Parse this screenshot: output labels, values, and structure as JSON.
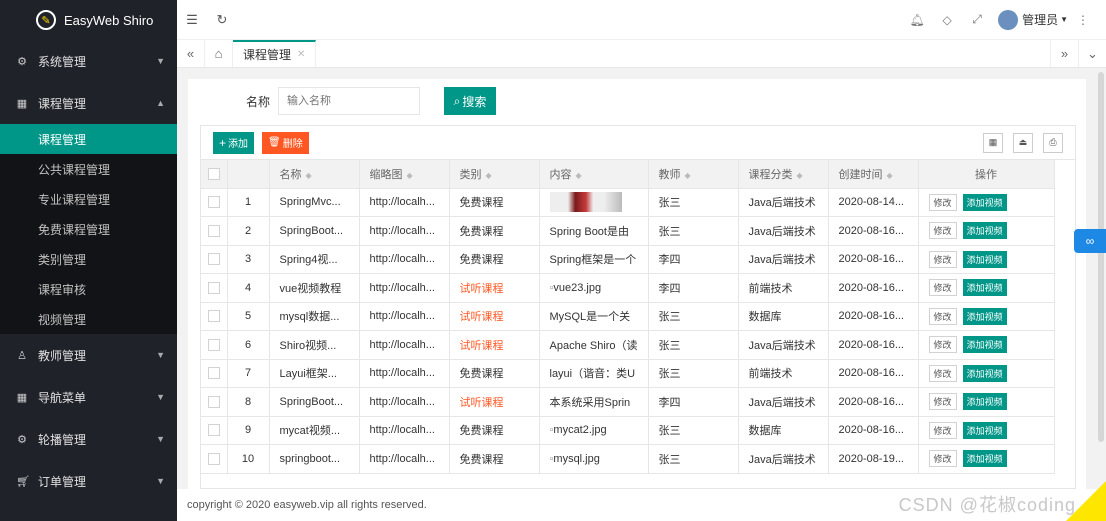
{
  "app": {
    "title": "EasyWeb Shiro"
  },
  "sidebar": {
    "groups": [
      {
        "label": "系统管理",
        "icon": "gear-icon",
        "expanded": false
      },
      {
        "label": "课程管理",
        "icon": "apps-icon",
        "expanded": true,
        "items": [
          "课程管理",
          "公共课程管理",
          "专业课程管理",
          "免费课程管理",
          "类别管理",
          "课程审核",
          "视频管理"
        ],
        "active_item": "课程管理"
      },
      {
        "label": "教师管理",
        "icon": "user-icon",
        "expanded": false
      },
      {
        "label": "导航菜单",
        "icon": "apps-icon",
        "expanded": false
      },
      {
        "label": "轮播管理",
        "icon": "gear-icon",
        "expanded": false
      },
      {
        "label": "订单管理",
        "icon": "cart-icon",
        "expanded": false
      }
    ]
  },
  "header": {
    "user": "管理员"
  },
  "tabs": [
    {
      "label": "课程管理",
      "active": true
    }
  ],
  "search": {
    "label": "名称",
    "placeholder": "输入名称",
    "button": "搜索"
  },
  "toolbar": {
    "add": "添加",
    "delete": "删除"
  },
  "table": {
    "columns": [
      "名称",
      "缩略图",
      "类别",
      "内容",
      "教师",
      "课程分类",
      "创建时间",
      "操作"
    ],
    "edit_label": "修改",
    "video_label": "添加视频",
    "rows": [
      {
        "no": "1",
        "name": "SpringMvc...",
        "thumb_url": "http://localh...",
        "category": "免费课程",
        "content": "",
        "content_is_image": true,
        "teacher": "张三",
        "course_class": "Java后端技术",
        "created": "2020-08-14..."
      },
      {
        "no": "2",
        "name": "SpringBoot...",
        "thumb_url": "http://localh...",
        "category": "免费课程",
        "content": "Spring Boot是由",
        "teacher": "张三",
        "course_class": "Java后端技术",
        "created": "2020-08-16..."
      },
      {
        "no": "3",
        "name": "Spring4视...",
        "thumb_url": "http://localh...",
        "category": "免费课程",
        "content": "Spring框架是一个",
        "teacher": "李四",
        "course_class": "Java后端技术",
        "created": "2020-08-16..."
      },
      {
        "no": "4",
        "name": "vue视频教程",
        "thumb_url": "http://localh...",
        "category": "试听课程",
        "content": "vue23.jpg",
        "broken_image": true,
        "teacher": "李四",
        "course_class": "前端技术",
        "created": "2020-08-16..."
      },
      {
        "no": "5",
        "name": "mysql数据...",
        "thumb_url": "http://localh...",
        "category": "试听课程",
        "content": "MySQL是一个关",
        "teacher": "张三",
        "course_class": "数据库",
        "created": "2020-08-16..."
      },
      {
        "no": "6",
        "name": "Shiro视频...",
        "thumb_url": "http://localh...",
        "category": "试听课程",
        "content": "Apache Shiro（读",
        "teacher": "张三",
        "course_class": "Java后端技术",
        "created": "2020-08-16..."
      },
      {
        "no": "7",
        "name": "Layui框架...",
        "thumb_url": "http://localh...",
        "category": "免费课程",
        "content": "layui（谐音：类U",
        "teacher": "张三",
        "course_class": "前端技术",
        "created": "2020-08-16..."
      },
      {
        "no": "8",
        "name": "SpringBoot...",
        "thumb_url": "http://localh...",
        "category": "试听课程",
        "content": "本系统采用Sprin",
        "teacher": "李四",
        "course_class": "Java后端技术",
        "created": "2020-08-16..."
      },
      {
        "no": "9",
        "name": "mycat视频...",
        "thumb_url": "http://localh...",
        "category": "免费课程",
        "content": "mycat2.jpg",
        "broken_image": true,
        "teacher": "张三",
        "course_class": "数据库",
        "created": "2020-08-16..."
      },
      {
        "no": "10",
        "name": "springboot...",
        "thumb_url": "http://localh...",
        "category": "免费课程",
        "content": "mysql.jpg",
        "broken_image": true,
        "teacher": "张三",
        "course_class": "Java后端技术",
        "created": "2020-08-19..."
      }
    ]
  },
  "footer": {
    "copyright": "copyright © 2020 easyweb.vip all rights reserved."
  },
  "watermark": "CSDN @花椒coding",
  "colors": {
    "accent": "#009688",
    "danger": "#ff5722",
    "sidebar": "#20222a"
  }
}
